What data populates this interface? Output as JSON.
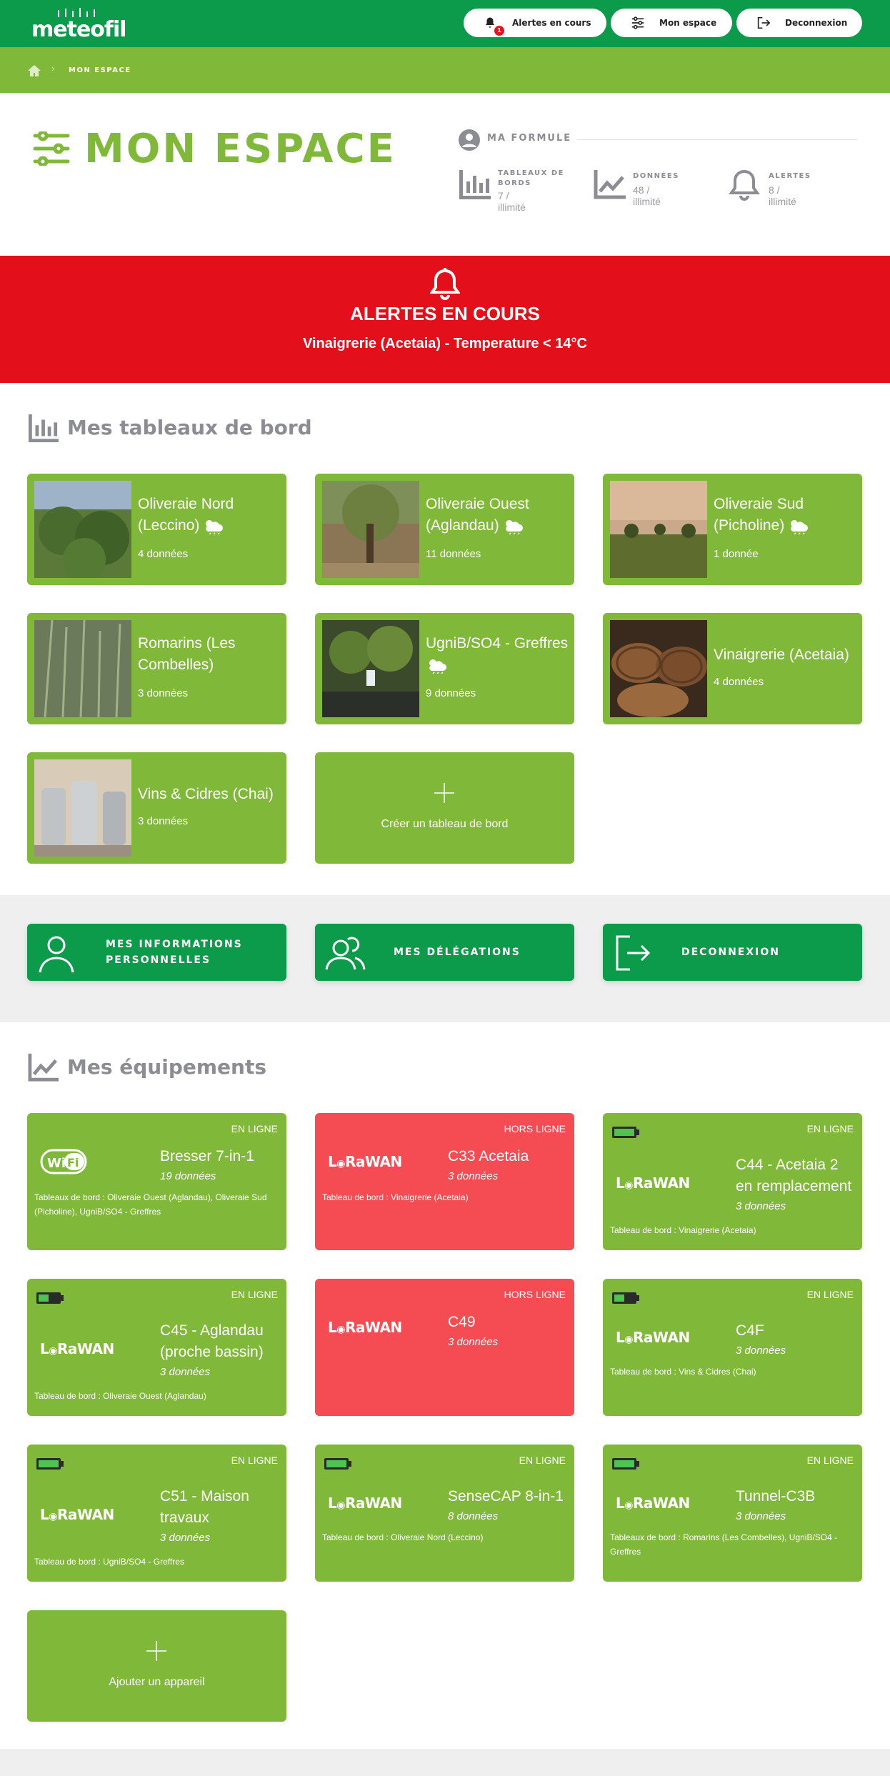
{
  "header": {
    "logo": "meteofil",
    "buttons": {
      "alerts": "Alertes en cours",
      "alerts_badge": "1",
      "space": "Mon espace",
      "logout": "Deconnexion"
    }
  },
  "breadcrumb": {
    "current": "MON ESPACE"
  },
  "page": {
    "title": "MON ESPACE"
  },
  "formule": {
    "label": "MA FORMULE",
    "stats": [
      {
        "label": "TABLEAUX DE BORDS",
        "value": "7 / illimité",
        "icon": "bar-chart-icon"
      },
      {
        "label": "DONNÉES",
        "value": "48 / illimité",
        "icon": "line-chart-icon"
      },
      {
        "label": "ALERTES",
        "value": "8 / illimité",
        "icon": "bell-icon"
      }
    ]
  },
  "alerts": {
    "title": "ALERTES EN COURS",
    "message": "Vinaigrerie (Acetaia) - Temperature < 14°C"
  },
  "dashboards": {
    "title": "Mes tableaux de bord",
    "items": [
      {
        "name": "Oliveraie Nord (Leccino)",
        "count": "4 données",
        "weather": true
      },
      {
        "name": "Oliveraie Ouest (Aglandau)",
        "count": "11 données",
        "weather": true
      },
      {
        "name": "Oliveraie Sud (Picholine)",
        "count": "1 donnée",
        "weather": true
      },
      {
        "name": "Romarins  (Les Combelles)",
        "count": "3 données",
        "weather": false
      },
      {
        "name": "UgniB/SO4 - Greffres",
        "count": "9 données",
        "weather": true
      },
      {
        "name": "Vinaigrerie (Acetaia)",
        "count": "4 données",
        "weather": false
      },
      {
        "name": "Vins & Cidres (Chai)",
        "count": "3 données",
        "weather": false
      }
    ],
    "create_label": "Créer un tableau de bord"
  },
  "account": {
    "infos": "MES INFORMATIONS PERSONNELLES",
    "delegations": "MES DÉLÉGATIONS",
    "logout": "DECONNEXION"
  },
  "devices": {
    "title": "Mes équipements",
    "items": [
      {
        "status": "EN LIGNE",
        "type": "WiFi",
        "name": "Bresser 7-in-1",
        "count": "19 données",
        "boards": "Tableaux de bord : Oliveraie Ouest (Aglandau), Oliveraie Sud (Picholine), UgniB/SO4 - Greffres",
        "online": true,
        "battery": false
      },
      {
        "status": "HORS LIGNE",
        "type": "LoRaWAN",
        "name": "C33 Acetaia",
        "count": "3 données",
        "boards": "Tableau de bord : Vinaigrerie (Acetaia)",
        "online": false,
        "battery": false
      },
      {
        "status": "EN LIGNE",
        "type": "LoRaWAN",
        "name": "C44 - Acetaia 2 en remplacement",
        "count": "3 données",
        "boards": "Tableau de bord : Vinaigrerie (Acetaia)",
        "online": true,
        "battery": true
      },
      {
        "status": "EN LIGNE",
        "type": "LoRaWAN",
        "name": "C45 - Aglandau (proche bassin)",
        "count": "3 données",
        "boards": "Tableau de bord : Oliveraie Ouest (Aglandau)",
        "online": true,
        "battery": true
      },
      {
        "status": "HORS LIGNE",
        "type": "LoRaWAN",
        "name": "C49",
        "count": "3 données",
        "boards": "",
        "online": false,
        "battery": false
      },
      {
        "status": "EN LIGNE",
        "type": "LoRaWAN",
        "name": "C4F",
        "count": "3 données",
        "boards": "Tableau de bord : Vins & Cidres (Chai)",
        "online": true,
        "battery": true
      },
      {
        "status": "EN LIGNE",
        "type": "LoRaWAN",
        "name": "C51 - Maison travaux",
        "count": "3 données",
        "boards": "Tableau de bord : UgniB/SO4 - Greffres",
        "online": true,
        "battery": true
      },
      {
        "status": "EN LIGNE",
        "type": "LoRaWAN",
        "name": "SenseCAP 8-in-1",
        "count": "8 données",
        "boards": "Tableau de bord : Oliveraie Nord (Leccino)",
        "online": true,
        "battery": true
      },
      {
        "status": "EN LIGNE",
        "type": "LoRaWAN",
        "name": "Tunnel-C3B",
        "count": "3 données",
        "boards": "Tableaux de bord : Romarins  (Les Combelles), UgniB/SO4 - Greffres",
        "online": true,
        "battery": true
      }
    ],
    "add_label": "Ajouter un appareil"
  },
  "colors": {
    "topbar": "#0c9a4b",
    "accent": "#80b83a",
    "alert": "#e30f1b",
    "offline": "#f44c52"
  }
}
